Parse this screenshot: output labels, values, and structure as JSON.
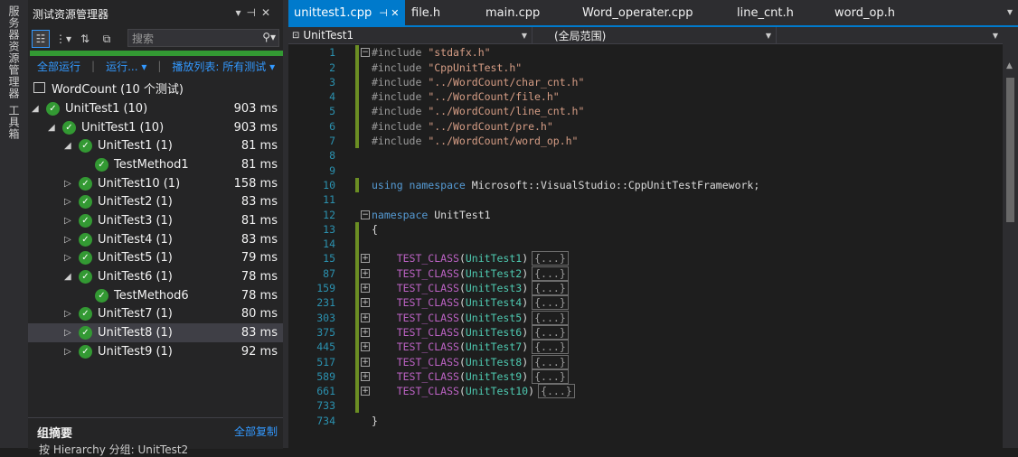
{
  "side_tabs": [
    "服务器资源管理器",
    "工具箱"
  ],
  "explorer": {
    "title": "测试资源管理器",
    "search_placeholder": "搜索",
    "run_all": "全部运行",
    "run": "运行...",
    "playlist": "播放列表: 所有测试",
    "root": "WordCount (10 个测试)",
    "tree": [
      {
        "label": "UnitTest1 (10)",
        "ms": "903 ms",
        "level": 0,
        "arrow": "open"
      },
      {
        "label": "UnitTest1 (10)",
        "ms": "903 ms",
        "level": 1,
        "arrow": "open"
      },
      {
        "label": "UnitTest1 (1)",
        "ms": "81 ms",
        "level": 2,
        "arrow": "open"
      },
      {
        "label": "TestMethod1",
        "ms": "81 ms",
        "level": 3,
        "arrow": ""
      },
      {
        "label": "UnitTest10 (1)",
        "ms": "158 ms",
        "level": 2,
        "arrow": "closed"
      },
      {
        "label": "UnitTest2 (1)",
        "ms": "83 ms",
        "level": 2,
        "arrow": "closed"
      },
      {
        "label": "UnitTest3 (1)",
        "ms": "81 ms",
        "level": 2,
        "arrow": "closed"
      },
      {
        "label": "UnitTest4 (1)",
        "ms": "83 ms",
        "level": 2,
        "arrow": "closed"
      },
      {
        "label": "UnitTest5 (1)",
        "ms": "79 ms",
        "level": 2,
        "arrow": "closed"
      },
      {
        "label": "UnitTest6 (1)",
        "ms": "78 ms",
        "level": 2,
        "arrow": "open"
      },
      {
        "label": "TestMethod6",
        "ms": "78 ms",
        "level": 3,
        "arrow": ""
      },
      {
        "label": "UnitTest7 (1)",
        "ms": "80 ms",
        "level": 2,
        "arrow": "closed"
      },
      {
        "label": "UnitTest8 (1)",
        "ms": "83 ms",
        "level": 2,
        "arrow": "closed",
        "selected": true
      },
      {
        "label": "UnitTest9 (1)",
        "ms": "92 ms",
        "level": 2,
        "arrow": "closed"
      }
    ],
    "summary_title": "组摘要",
    "copy_all": "全部复制",
    "summary_line": "按 Hierarchy 分组: UnitTest2"
  },
  "editor": {
    "tabs": [
      {
        "label": "unittest1.cpp",
        "active": true,
        "pin": "⊣ ✕"
      },
      {
        "label": "file.h"
      },
      {
        "label": "main.cpp"
      },
      {
        "label": "Word_operater.cpp"
      },
      {
        "label": "line_cnt.h"
      },
      {
        "label": "word_op.h"
      }
    ],
    "nav_left": "UnitTest1",
    "nav_mid": "(全局范围)",
    "collapsed_text": "{...}"
  },
  "code_lines": [
    {
      "n": "1",
      "parts": [
        [
          "pp",
          "#include "
        ],
        [
          "str",
          "\"stdafx.h\""
        ]
      ],
      "fold": "−"
    },
    {
      "n": "2",
      "parts": [
        [
          "pp",
          "#include "
        ],
        [
          "str",
          "\"CppUnitTest.h\""
        ]
      ]
    },
    {
      "n": "3",
      "parts": [
        [
          "pp",
          "#include "
        ],
        [
          "str",
          "\"../WordCount/char_cnt.h\""
        ]
      ]
    },
    {
      "n": "4",
      "parts": [
        [
          "pp",
          "#include "
        ],
        [
          "str",
          "\"../WordCount/file.h\""
        ]
      ]
    },
    {
      "n": "5",
      "parts": [
        [
          "pp",
          "#include "
        ],
        [
          "str",
          "\"../WordCount/line_cnt.h\""
        ]
      ]
    },
    {
      "n": "6",
      "parts": [
        [
          "pp",
          "#include "
        ],
        [
          "str",
          "\"../WordCount/pre.h\""
        ]
      ]
    },
    {
      "n": "7",
      "parts": [
        [
          "pp",
          "#include "
        ],
        [
          "str",
          "\"../WordCount/word_op.h\""
        ]
      ]
    },
    {
      "n": "8",
      "parts": []
    },
    {
      "n": "9",
      "parts": []
    },
    {
      "n": "10",
      "parts": [
        [
          "kw",
          "using namespace "
        ],
        [
          "plain",
          "Microsoft::VisualStudio::CppUnitTestFramework;"
        ]
      ]
    },
    {
      "n": "11",
      "parts": []
    },
    {
      "n": "12",
      "parts": [
        [
          "kw",
          "namespace "
        ],
        [
          "plain",
          "UnitTest1"
        ]
      ],
      "fold": "−"
    },
    {
      "n": "13",
      "parts": [
        [
          "plain",
          "{"
        ]
      ]
    },
    {
      "n": "14",
      "parts": []
    },
    {
      "n": "15",
      "parts": [
        [
          "mac",
          "    TEST_CLASS"
        ],
        [
          "plain",
          "("
        ],
        [
          "cls",
          "UnitTest1"
        ],
        [
          "plain",
          ")"
        ]
      ],
      "fold": "+",
      "collapsed": true
    },
    {
      "n": "87",
      "parts": [
        [
          "mac",
          "    TEST_CLASS"
        ],
        [
          "plain",
          "("
        ],
        [
          "cls",
          "UnitTest2"
        ],
        [
          "plain",
          ")"
        ]
      ],
      "fold": "+",
      "collapsed": true
    },
    {
      "n": "159",
      "parts": [
        [
          "mac",
          "    TEST_CLASS"
        ],
        [
          "plain",
          "("
        ],
        [
          "cls",
          "UnitTest3"
        ],
        [
          "plain",
          ")"
        ]
      ],
      "fold": "+",
      "collapsed": true
    },
    {
      "n": "231",
      "parts": [
        [
          "mac",
          "    TEST_CLASS"
        ],
        [
          "plain",
          "("
        ],
        [
          "cls",
          "UnitTest4"
        ],
        [
          "plain",
          ")"
        ]
      ],
      "fold": "+",
      "collapsed": true
    },
    {
      "n": "303",
      "parts": [
        [
          "mac",
          "    TEST_CLASS"
        ],
        [
          "plain",
          "("
        ],
        [
          "cls",
          "UnitTest5"
        ],
        [
          "plain",
          ")"
        ]
      ],
      "fold": "+",
      "collapsed": true
    },
    {
      "n": "375",
      "parts": [
        [
          "mac",
          "    TEST_CLASS"
        ],
        [
          "plain",
          "("
        ],
        [
          "cls",
          "UnitTest6"
        ],
        [
          "plain",
          ")"
        ]
      ],
      "fold": "+",
      "collapsed": true
    },
    {
      "n": "445",
      "parts": [
        [
          "mac",
          "    TEST_CLASS"
        ],
        [
          "plain",
          "("
        ],
        [
          "cls",
          "UnitTest7"
        ],
        [
          "plain",
          ")"
        ]
      ],
      "fold": "+",
      "collapsed": true
    },
    {
      "n": "517",
      "parts": [
        [
          "mac",
          "    TEST_CLASS"
        ],
        [
          "plain",
          "("
        ],
        [
          "cls",
          "UnitTest8"
        ],
        [
          "plain",
          ")"
        ]
      ],
      "fold": "+",
      "collapsed": true
    },
    {
      "n": "589",
      "parts": [
        [
          "mac",
          "    TEST_CLASS"
        ],
        [
          "plain",
          "("
        ],
        [
          "cls",
          "UnitTest9"
        ],
        [
          "plain",
          ")"
        ]
      ],
      "fold": "+",
      "collapsed": true
    },
    {
      "n": "661",
      "parts": [
        [
          "mac",
          "    TEST_CLASS"
        ],
        [
          "plain",
          "("
        ],
        [
          "cls",
          "UnitTest10"
        ],
        [
          "plain",
          ")"
        ]
      ],
      "fold": "+",
      "collapsed": true
    },
    {
      "n": "733",
      "parts": []
    },
    {
      "n": "734",
      "parts": [
        [
          "plain",
          "}"
        ]
      ]
    }
  ],
  "colors": {
    "accent": "#007acc",
    "pass_green": "#339933",
    "link_blue": "#3399ff"
  }
}
